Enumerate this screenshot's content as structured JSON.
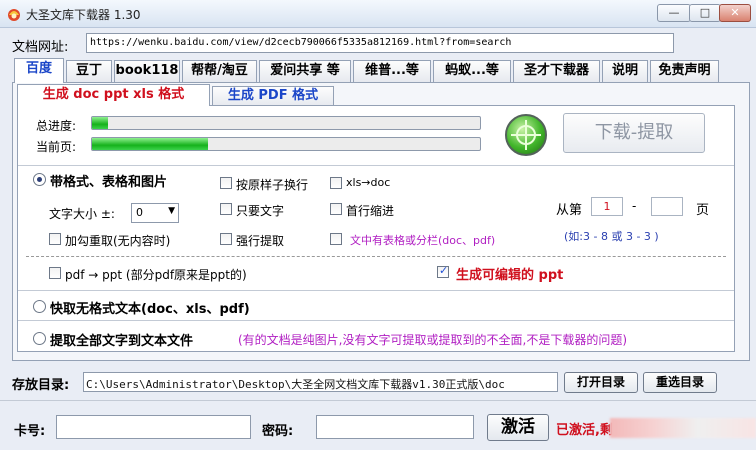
{
  "window": {
    "title": "大圣文库下载器 1.30",
    "minimize_glyph": "—",
    "maximize_glyph": "□",
    "close_glyph": "✕"
  },
  "url_bar": {
    "label": "文档网址:",
    "value": "https://wenku.baidu.com/view/d2cecb790066f5335a812169.html?from=search"
  },
  "tabs": [
    {
      "label": "百度",
      "active": true
    },
    {
      "label": "豆丁",
      "active": false
    },
    {
      "label": "book118",
      "active": false
    },
    {
      "label": "帮帮/淘豆",
      "active": false
    },
    {
      "label": "爱问共享 等",
      "active": false
    },
    {
      "label": "维普...等",
      "active": false
    },
    {
      "label": "蚂蚁...等",
      "active": false
    },
    {
      "label": "圣才下载器",
      "active": false
    },
    {
      "label": "说明",
      "active": false
    },
    {
      "label": "免责声明",
      "active": false
    }
  ],
  "subtabs": [
    {
      "label": "生成 doc ppt xls 格式",
      "active": true
    },
    {
      "label": "生成 PDF 格式",
      "active": false
    }
  ],
  "progress": {
    "total_label": "总进度:",
    "total_fraction": 0.04,
    "current_label": "当前页:",
    "current_fraction": 0.3
  },
  "download_button": {
    "label": "下载-提取",
    "enabled": false
  },
  "options": {
    "format_mode": {
      "label": "带格式、表格和图片",
      "selected": true
    },
    "font_size": {
      "label": "文字大小 ±:",
      "value": "0"
    },
    "reweight": {
      "label": "加勾重取(无内容时)",
      "checked": false
    },
    "keep_linebreak": {
      "label": "按原样子换行",
      "checked": false
    },
    "text_only": {
      "label": "只要文字",
      "checked": false
    },
    "force_extract": {
      "label": "强行提取",
      "checked": false
    },
    "xls_to_doc": {
      "label": "xls→doc",
      "checked": false
    },
    "first_indent": {
      "label": "首行缩进",
      "checked": false
    },
    "table_columns": {
      "label": "文中有表格或分栏(doc、pdf)",
      "checked": false
    },
    "page_range": {
      "from_label": "从第",
      "from_value": "1",
      "dash": "-",
      "to_value": "",
      "page_label": "页",
      "hint": "(如:3 - 8 或 3 - 3 )"
    },
    "pdf_to_ppt": {
      "label": "pdf → ppt (部分pdf原来是ppt的)",
      "checked": false
    },
    "editable_ppt": {
      "label": "生成可编辑的 ppt",
      "checked": true
    },
    "quick_text": {
      "label": "快取无格式文本(doc、xls、pdf)",
      "selected": false
    },
    "extract_all": {
      "label": "提取全部文字到文本文件",
      "selected": false
    },
    "notice": "(有的文档是纯图片,没有文字可提取或提取到的不全面,不是下载器的问题)"
  },
  "save_dir": {
    "label": "存放目录:",
    "value": "C:\\Users\\Administrator\\Desktop\\大圣全网文档文库下载器v1.30正式版\\doc",
    "open_label": "打开目录",
    "reselect_label": "重选目录"
  },
  "activation": {
    "card_label": "卡号:",
    "card_value": "",
    "password_label": "密码:",
    "password_value": "",
    "activate_label": "激活",
    "status": "已激活,剩"
  },
  "colors": {
    "accent_blue": "#1b46c8",
    "accent_red": "#d0101e",
    "notice_magenta": "#b01ec2",
    "hint_blue": "#2a3fb0",
    "progress_green": "#16b21c"
  }
}
